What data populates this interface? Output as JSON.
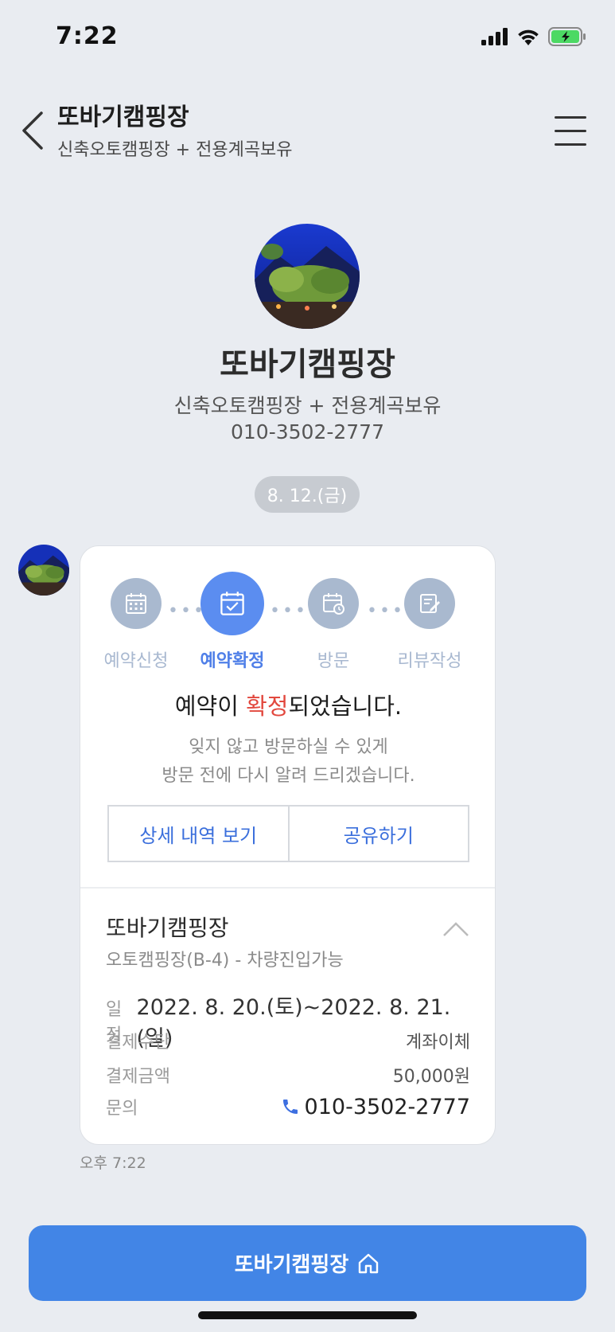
{
  "status_bar": {
    "time": "7:22"
  },
  "header": {
    "title": "또바기캠핑장",
    "subtitle": "신축오토캠핑장 + 전용계곡보유"
  },
  "profile": {
    "name": "또바기캠핑장",
    "description": "신축오토캠핑장 + 전용계곡보유",
    "phone": "010-3502-2777"
  },
  "date_divider": "8. 12.(금)",
  "card": {
    "steps": [
      {
        "label": "예약신청",
        "icon": "calendar-grid-icon",
        "active": false
      },
      {
        "label": "예약확정",
        "icon": "calendar-check-icon",
        "active": true
      },
      {
        "label": "방문",
        "icon": "calendar-clock-icon",
        "active": false
      },
      {
        "label": "리뷰작성",
        "icon": "edit-note-icon",
        "active": false
      }
    ],
    "message_prefix": "예약이 ",
    "message_highlight": "확정",
    "message_suffix": "되었습니다.",
    "sub_line1": "잊지 않고 방문하실 수 있게",
    "sub_line2": "방문 전에 다시 알려 드리겠습니다.",
    "detail_button": "상세 내역 보기",
    "share_button": "공유하기",
    "details": {
      "title": "또바기캠핑장",
      "site": "오토캠핑장(B-4) - 차량진입가능",
      "schedule_label": "일정",
      "schedule_value": "2022. 8. 20.(토)~2022. 8. 21.(일)",
      "payment_method_label": "결제수단",
      "payment_method_value": "계좌이체",
      "amount_label": "결제금액",
      "amount_value": "50,000원",
      "contact_label": "문의",
      "contact_value": "010-3502-2777"
    }
  },
  "timestamp": "오후 7:22",
  "bottom_button": "또바기캠핑장",
  "colors": {
    "accent": "#4285e6",
    "highlight": "#e2483e",
    "step_active": "#5b8df0",
    "step_inactive": "#a9b9cf"
  }
}
